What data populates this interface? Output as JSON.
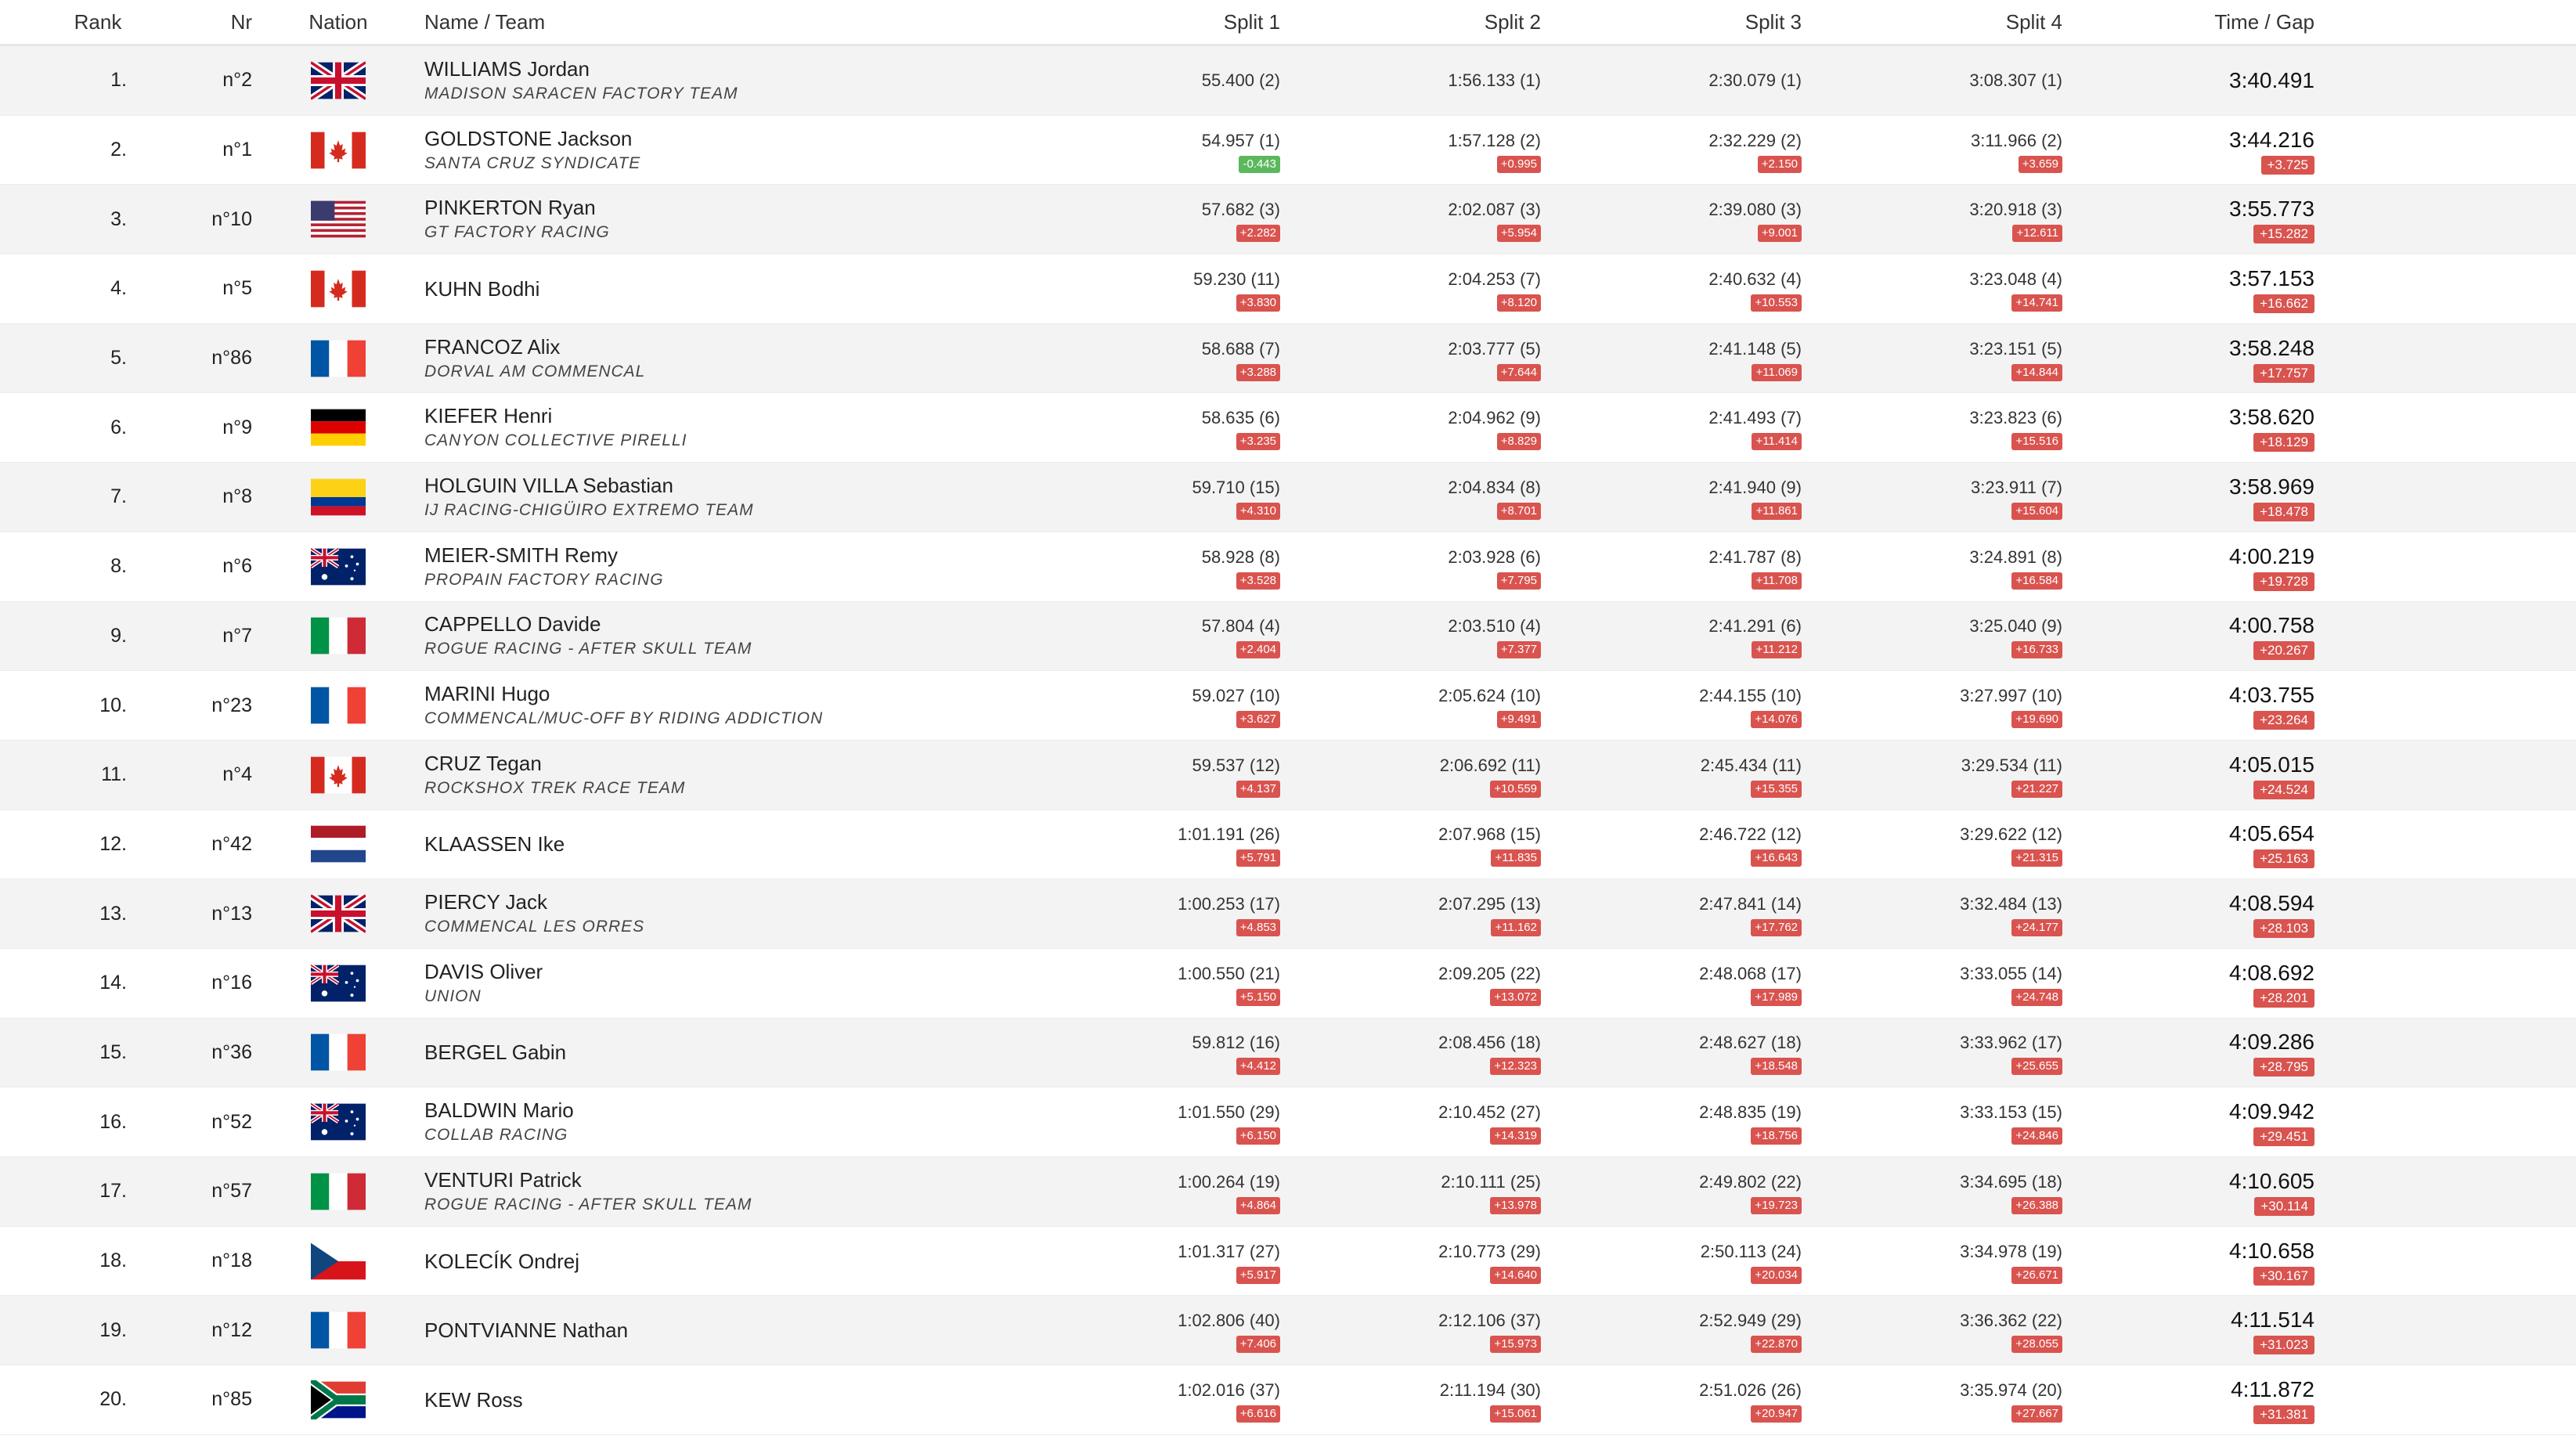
{
  "headers": {
    "rank": "Rank",
    "nr": "Nr",
    "nation": "Nation",
    "name_team": "Name / Team",
    "split1": "Split 1",
    "split2": "Split 2",
    "split3": "Split 3",
    "split4": "Split 4",
    "time_gap": "Time / Gap"
  },
  "rows": [
    {
      "rank": "1.",
      "nr": "n°2",
      "nation": "gb",
      "name": "WILLIAMS Jordan",
      "team": "MADISON SARACEN FACTORY TEAM",
      "s1": "55.400 (2)",
      "s1g": "",
      "s2": "1:56.133 (1)",
      "s2g": "",
      "s3": "2:30.079 (1)",
      "s3g": "",
      "s4": "3:08.307 (1)",
      "s4g": "",
      "time": "3:40.491",
      "gap": ""
    },
    {
      "rank": "2.",
      "nr": "n°1",
      "nation": "ca",
      "name": "GOLDSTONE Jackson",
      "team": "SANTA CRUZ SYNDICATE",
      "s1": "54.957 (1)",
      "s1g": "-0.443",
      "s2": "1:57.128 (2)",
      "s2g": "+0.995",
      "s3": "2:32.229 (2)",
      "s3g": "+2.150",
      "s4": "3:11.966 (2)",
      "s4g": "+3.659",
      "time": "3:44.216",
      "gap": "+3.725"
    },
    {
      "rank": "3.",
      "nr": "n°10",
      "nation": "us",
      "name": "PINKERTON Ryan",
      "team": "GT FACTORY RACING",
      "s1": "57.682 (3)",
      "s1g": "+2.282",
      "s2": "2:02.087 (3)",
      "s2g": "+5.954",
      "s3": "2:39.080 (3)",
      "s3g": "+9.001",
      "s4": "3:20.918 (3)",
      "s4g": "+12.611",
      "time": "3:55.773",
      "gap": "+15.282"
    },
    {
      "rank": "4.",
      "nr": "n°5",
      "nation": "ca",
      "name": "KUHN Bodhi",
      "team": "",
      "s1": "59.230 (11)",
      "s1g": "+3.830",
      "s2": "2:04.253 (7)",
      "s2g": "+8.120",
      "s3": "2:40.632 (4)",
      "s3g": "+10.553",
      "s4": "3:23.048 (4)",
      "s4g": "+14.741",
      "time": "3:57.153",
      "gap": "+16.662"
    },
    {
      "rank": "5.",
      "nr": "n°86",
      "nation": "fr",
      "name": "FRANCOZ Alix",
      "team": "DORVAL AM COMMENCAL",
      "s1": "58.688 (7)",
      "s1g": "+3.288",
      "s2": "2:03.777 (5)",
      "s2g": "+7.644",
      "s3": "2:41.148 (5)",
      "s3g": "+11.069",
      "s4": "3:23.151 (5)",
      "s4g": "+14.844",
      "time": "3:58.248",
      "gap": "+17.757"
    },
    {
      "rank": "6.",
      "nr": "n°9",
      "nation": "de",
      "name": "KIEFER Henri",
      "team": "CANYON COLLECTIVE PIRELLI",
      "s1": "58.635 (6)",
      "s1g": "+3.235",
      "s2": "2:04.962 (9)",
      "s2g": "+8.829",
      "s3": "2:41.493 (7)",
      "s3g": "+11.414",
      "s4": "3:23.823 (6)",
      "s4g": "+15.516",
      "time": "3:58.620",
      "gap": "+18.129"
    },
    {
      "rank": "7.",
      "nr": "n°8",
      "nation": "co",
      "name": "HOLGUIN VILLA Sebastian",
      "team": "IJ RACING-CHIGÜIRO EXTREMO TEAM",
      "s1": "59.710 (15)",
      "s1g": "+4.310",
      "s2": "2:04.834 (8)",
      "s2g": "+8.701",
      "s3": "2:41.940 (9)",
      "s3g": "+11.861",
      "s4": "3:23.911 (7)",
      "s4g": "+15.604",
      "time": "3:58.969",
      "gap": "+18.478"
    },
    {
      "rank": "8.",
      "nr": "n°6",
      "nation": "au",
      "name": "MEIER-SMITH Remy",
      "team": "PROPAIN FACTORY RACING",
      "s1": "58.928 (8)",
      "s1g": "+3.528",
      "s2": "2:03.928 (6)",
      "s2g": "+7.795",
      "s3": "2:41.787 (8)",
      "s3g": "+11.708",
      "s4": "3:24.891 (8)",
      "s4g": "+16.584",
      "time": "4:00.219",
      "gap": "+19.728"
    },
    {
      "rank": "9.",
      "nr": "n°7",
      "nation": "it",
      "name": "CAPPELLO Davide",
      "team": "ROGUE RACING - AFTER SKULL TEAM",
      "s1": "57.804 (4)",
      "s1g": "+2.404",
      "s2": "2:03.510 (4)",
      "s2g": "+7.377",
      "s3": "2:41.291 (6)",
      "s3g": "+11.212",
      "s4": "3:25.040 (9)",
      "s4g": "+16.733",
      "time": "4:00.758",
      "gap": "+20.267"
    },
    {
      "rank": "10.",
      "nr": "n°23",
      "nation": "fr",
      "name": "MARINI Hugo",
      "team": "COMMENCAL/MUC-OFF BY RIDING ADDICTION",
      "s1": "59.027 (10)",
      "s1g": "+3.627",
      "s2": "2:05.624 (10)",
      "s2g": "+9.491",
      "s3": "2:44.155 (10)",
      "s3g": "+14.076",
      "s4": "3:27.997 (10)",
      "s4g": "+19.690",
      "time": "4:03.755",
      "gap": "+23.264"
    },
    {
      "rank": "11.",
      "nr": "n°4",
      "nation": "ca",
      "name": "CRUZ Tegan",
      "team": "ROCKSHOX TREK RACE TEAM",
      "s1": "59.537 (12)",
      "s1g": "+4.137",
      "s2": "2:06.692 (11)",
      "s2g": "+10.559",
      "s3": "2:45.434 (11)",
      "s3g": "+15.355",
      "s4": "3:29.534 (11)",
      "s4g": "+21.227",
      "time": "4:05.015",
      "gap": "+24.524"
    },
    {
      "rank": "12.",
      "nr": "n°42",
      "nation": "nl",
      "name": "KLAASSEN Ike",
      "team": "",
      "s1": "1:01.191 (26)",
      "s1g": "+5.791",
      "s2": "2:07.968 (15)",
      "s2g": "+11.835",
      "s3": "2:46.722 (12)",
      "s3g": "+16.643",
      "s4": "3:29.622 (12)",
      "s4g": "+21.315",
      "time": "4:05.654",
      "gap": "+25.163"
    },
    {
      "rank": "13.",
      "nr": "n°13",
      "nation": "gb",
      "name": "PIERCY Jack",
      "team": "COMMENCAL LES ORRES",
      "s1": "1:00.253 (17)",
      "s1g": "+4.853",
      "s2": "2:07.295 (13)",
      "s2g": "+11.162",
      "s3": "2:47.841 (14)",
      "s3g": "+17.762",
      "s4": "3:32.484 (13)",
      "s4g": "+24.177",
      "time": "4:08.594",
      "gap": "+28.103"
    },
    {
      "rank": "14.",
      "nr": "n°16",
      "nation": "au",
      "name": "DAVIS Oliver",
      "team": "UNION",
      "s1": "1:00.550 (21)",
      "s1g": "+5.150",
      "s2": "2:09.205 (22)",
      "s2g": "+13.072",
      "s3": "2:48.068 (17)",
      "s3g": "+17.989",
      "s4": "3:33.055 (14)",
      "s4g": "+24.748",
      "time": "4:08.692",
      "gap": "+28.201"
    },
    {
      "rank": "15.",
      "nr": "n°36",
      "nation": "fr",
      "name": "BERGEL Gabin",
      "team": "",
      "s1": "59.812 (16)",
      "s1g": "+4.412",
      "s2": "2:08.456 (18)",
      "s2g": "+12.323",
      "s3": "2:48.627 (18)",
      "s3g": "+18.548",
      "s4": "3:33.962 (17)",
      "s4g": "+25.655",
      "time": "4:09.286",
      "gap": "+28.795"
    },
    {
      "rank": "16.",
      "nr": "n°52",
      "nation": "au",
      "name": "BALDWIN Mario",
      "team": "COLLAB RACING",
      "s1": "1:01.550 (29)",
      "s1g": "+6.150",
      "s2": "2:10.452 (27)",
      "s2g": "+14.319",
      "s3": "2:48.835 (19)",
      "s3g": "+18.756",
      "s4": "3:33.153 (15)",
      "s4g": "+24.846",
      "time": "4:09.942",
      "gap": "+29.451"
    },
    {
      "rank": "17.",
      "nr": "n°57",
      "nation": "it",
      "name": "VENTURI Patrick",
      "team": "ROGUE RACING - AFTER SKULL TEAM",
      "s1": "1:00.264 (19)",
      "s1g": "+4.864",
      "s2": "2:10.111 (25)",
      "s2g": "+13.978",
      "s3": "2:49.802 (22)",
      "s3g": "+19.723",
      "s4": "3:34.695 (18)",
      "s4g": "+26.388",
      "time": "4:10.605",
      "gap": "+30.114"
    },
    {
      "rank": "18.",
      "nr": "n°18",
      "nation": "cz",
      "name": "KOLECÍK Ondrej",
      "team": "",
      "s1": "1:01.317 (27)",
      "s1g": "+5.917",
      "s2": "2:10.773 (29)",
      "s2g": "+14.640",
      "s3": "2:50.113 (24)",
      "s3g": "+20.034",
      "s4": "3:34.978 (19)",
      "s4g": "+26.671",
      "time": "4:10.658",
      "gap": "+30.167"
    },
    {
      "rank": "19.",
      "nr": "n°12",
      "nation": "fr",
      "name": "PONTVIANNE Nathan",
      "team": "",
      "s1": "1:02.806 (40)",
      "s1g": "+7.406",
      "s2": "2:12.106 (37)",
      "s2g": "+15.973",
      "s3": "2:52.949 (29)",
      "s3g": "+22.870",
      "s4": "3:36.362 (22)",
      "s4g": "+28.055",
      "time": "4:11.514",
      "gap": "+31.023"
    },
    {
      "rank": "20.",
      "nr": "n°85",
      "nation": "za",
      "name": "KEW Ross",
      "team": "",
      "s1": "1:02.016 (37)",
      "s1g": "+6.616",
      "s2": "2:11.194 (30)",
      "s2g": "+15.061",
      "s3": "2:51.026 (26)",
      "s3g": "+20.947",
      "s4": "3:35.974 (20)",
      "s4g": "+27.667",
      "time": "4:11.872",
      "gap": "+31.381"
    }
  ],
  "colors": {
    "gap_positive": "#d9534f",
    "gap_negative": "#5cb85c",
    "row_alt": "#f3f3f3"
  }
}
